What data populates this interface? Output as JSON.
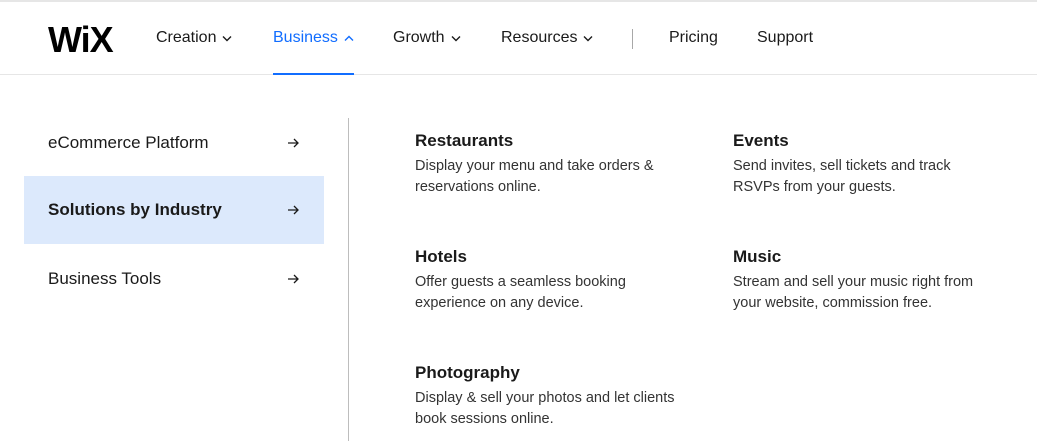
{
  "brand": {
    "logo_text": "WiX"
  },
  "nav": {
    "items": [
      {
        "label": "Creation",
        "has_chevron": true,
        "active": false
      },
      {
        "label": "Business",
        "has_chevron": true,
        "active": true
      },
      {
        "label": "Growth",
        "has_chevron": true,
        "active": false
      },
      {
        "label": "Resources",
        "has_chevron": true,
        "active": false
      },
      {
        "label": "Pricing",
        "has_chevron": false,
        "active": false
      },
      {
        "label": "Support",
        "has_chevron": false,
        "active": false
      }
    ],
    "accent_color": "#116dff"
  },
  "menu": {
    "items": [
      {
        "label": "eCommerce Platform",
        "selected": false,
        "icon": "arrow-right-icon"
      },
      {
        "label": "Solutions by Industry",
        "selected": true,
        "icon": "arrow-right-icon"
      },
      {
        "label": "Business Tools",
        "selected": false,
        "icon": "arrow-right-icon"
      }
    ],
    "selected_bg": "#dce9fc"
  },
  "industries": [
    {
      "title": "Restaurants",
      "description_line1": "Display your menu and take orders &",
      "description_line2": "reservations online."
    },
    {
      "title": "Events",
      "description_line1": "Send invites, sell tickets and track",
      "description_line2": "RSVPs from your guests."
    },
    {
      "title": "Hotels",
      "description_line1": "Offer guests a seamless booking",
      "description_line2": "experience on any device."
    },
    {
      "title": "Music",
      "description_line1": "Stream and sell your music right from",
      "description_line2": "your website, commission free."
    },
    {
      "title": "Photography",
      "description_line1": "Display & sell your photos and let clients",
      "description_line2": "book sessions online."
    }
  ]
}
